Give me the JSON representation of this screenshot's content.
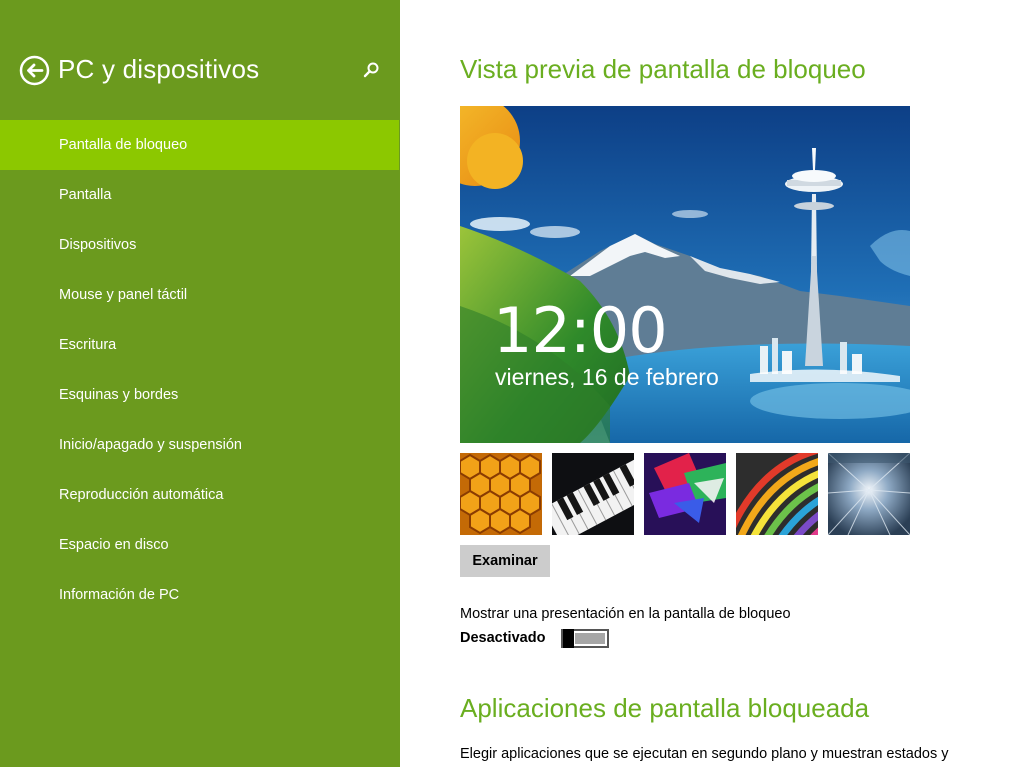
{
  "sidebar": {
    "title": "PC y dispositivos",
    "back_icon": "back-arrow-circle-icon",
    "search_icon": "search-icon",
    "background": "#6b9a1e",
    "selected_background": "#8cc800",
    "items": [
      {
        "label": "Pantalla de bloqueo",
        "selected": true
      },
      {
        "label": "Pantalla"
      },
      {
        "label": "Dispositivos"
      },
      {
        "label": "Mouse y panel táctil"
      },
      {
        "label": "Escritura"
      },
      {
        "label": "Esquinas y bordes"
      },
      {
        "label": "Inicio/apagado y suspensión"
      },
      {
        "label": "Reproducción automática"
      },
      {
        "label": "Espacio en disco"
      },
      {
        "label": "Información de PC"
      }
    ]
  },
  "main": {
    "accent": "#6aae20",
    "preview_heading": "Vista previa de pantalla de bloqueo",
    "preview": {
      "time": "12:00",
      "date": "viernes, 16 de febrero"
    },
    "thumbnails": [
      {
        "name": "honeycomb"
      },
      {
        "name": "piano-keys"
      },
      {
        "name": "geometric-shapes"
      },
      {
        "name": "colorful-stripes"
      },
      {
        "name": "tunnel-lights"
      }
    ],
    "browse_label": "Examinar",
    "slideshow": {
      "label": "Mostrar una presentación en la pantalla de bloqueo",
      "state": "Desactivado"
    },
    "apps_heading": "Aplicaciones de pantalla bloqueada",
    "apps_description": "Elegir aplicaciones que se ejecutan en segundo plano y muestran estados y"
  }
}
